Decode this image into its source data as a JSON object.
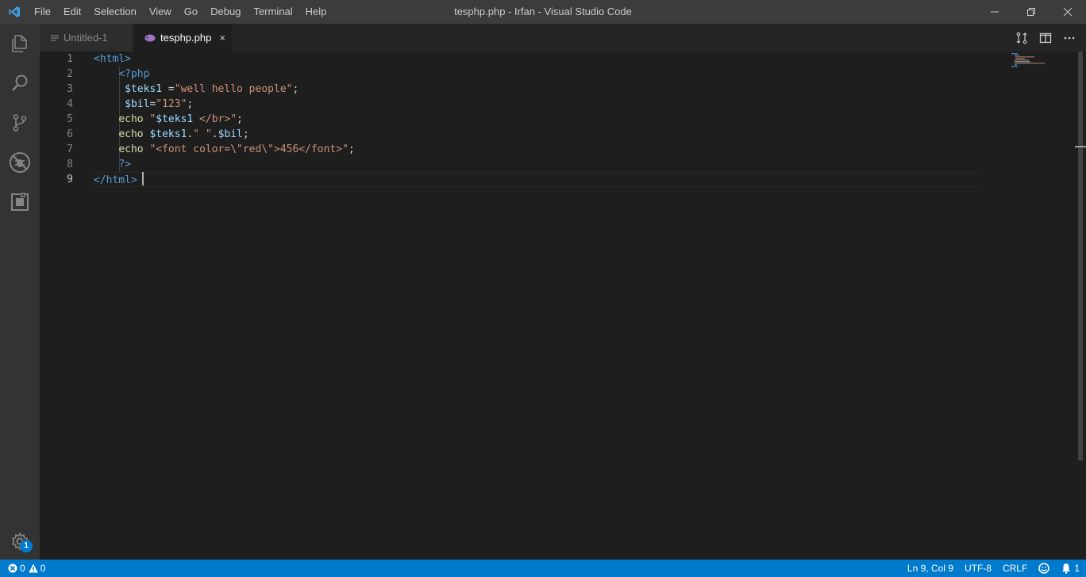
{
  "window": {
    "title": "tesphp.php - Irfan - Visual Studio Code",
    "menu": [
      "File",
      "Edit",
      "Selection",
      "View",
      "Go",
      "Debug",
      "Terminal",
      "Help"
    ]
  },
  "activity_bar": {
    "items": [
      "explorer-icon",
      "search-icon",
      "source-control-icon",
      "debug-icon",
      "extensions-icon"
    ],
    "manage_badge": "1"
  },
  "tabs": [
    {
      "label": "Untitled-1",
      "active": false,
      "icon": "file-icon"
    },
    {
      "label": "tesphp.php",
      "active": true,
      "icon": "php-icon",
      "close": "×"
    }
  ],
  "editor": {
    "line_numbers": [
      "1",
      "2",
      "3",
      "4",
      "5",
      "6",
      "7",
      "8",
      "9"
    ],
    "current_line": 9,
    "lines": [
      [
        {
          "t": "<html>",
          "c": "tag"
        }
      ],
      [
        {
          "t": "    ",
          "c": "plain"
        },
        {
          "t": "<?php",
          "c": "tag"
        }
      ],
      [
        {
          "t": "     ",
          "c": "plain"
        },
        {
          "t": "$teks1",
          "c": "var"
        },
        {
          "t": " =",
          "c": "plain"
        },
        {
          "t": "\"well hello people\"",
          "c": "str"
        },
        {
          "t": ";",
          "c": "plain"
        }
      ],
      [
        {
          "t": "     ",
          "c": "plain"
        },
        {
          "t": "$bil",
          "c": "var"
        },
        {
          "t": "=",
          "c": "plain"
        },
        {
          "t": "\"123\"",
          "c": "str"
        },
        {
          "t": ";",
          "c": "plain"
        }
      ],
      [
        {
          "t": "    ",
          "c": "plain"
        },
        {
          "t": "echo",
          "c": "kw"
        },
        {
          "t": " ",
          "c": "plain"
        },
        {
          "t": "\"",
          "c": "str"
        },
        {
          "t": "$teks1",
          "c": "var"
        },
        {
          "t": " </br>\"",
          "c": "str"
        },
        {
          "t": ";",
          "c": "plain"
        }
      ],
      [
        {
          "t": "    ",
          "c": "plain"
        },
        {
          "t": "echo",
          "c": "kw"
        },
        {
          "t": " ",
          "c": "plain"
        },
        {
          "t": "$teks1",
          "c": "var"
        },
        {
          "t": ".",
          "c": "plain"
        },
        {
          "t": "\" \"",
          "c": "str"
        },
        {
          "t": ".",
          "c": "plain"
        },
        {
          "t": "$bil",
          "c": "var"
        },
        {
          "t": ";",
          "c": "plain"
        }
      ],
      [
        {
          "t": "    ",
          "c": "plain"
        },
        {
          "t": "echo",
          "c": "kw"
        },
        {
          "t": " ",
          "c": "plain"
        },
        {
          "t": "\"<font color=\\\"red\\\">456</font>\"",
          "c": "str"
        },
        {
          "t": ";",
          "c": "plain"
        }
      ],
      [
        {
          "t": "    ",
          "c": "plain"
        },
        {
          "t": "?>",
          "c": "tag"
        }
      ],
      [
        {
          "t": "</html>",
          "c": "tag"
        }
      ]
    ]
  },
  "status_bar": {
    "errors": "0",
    "warnings": "0",
    "position": "Ln 9, Col 9",
    "encoding": "UTF-8",
    "eol": "CRLF",
    "notifications": "1"
  },
  "colors": {
    "titlebar": "#3c3c3c",
    "activitybar": "#333333",
    "editor_bg": "#1e1e1e",
    "statusbar": "#007acc",
    "tag": "#569cd6",
    "variable": "#9cdcfe",
    "string": "#ce9178",
    "keyword": "#dcdcaa"
  }
}
